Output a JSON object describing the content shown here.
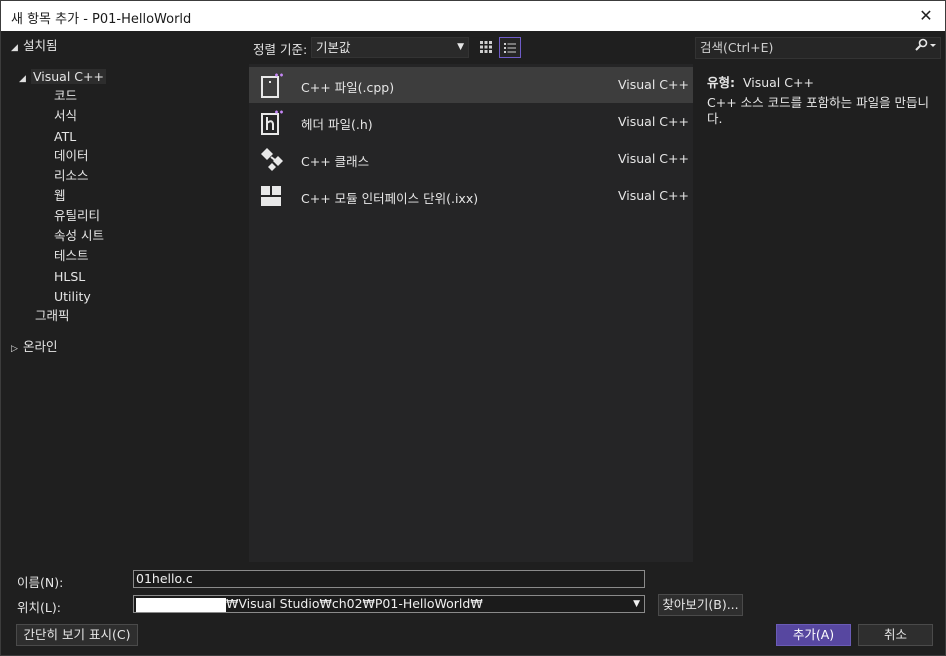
{
  "window": {
    "title": "새 항목 추가 - P01-HelloWorld",
    "close": "✕"
  },
  "tree": {
    "installed": "설치됨",
    "visual_cpp": "Visual C++",
    "children": [
      "코드",
      "서식",
      "ATL",
      "데이터",
      "리소스",
      "웹",
      "유틸리티",
      "속성 시트",
      "테스트",
      "HLSL",
      "Utility"
    ],
    "graphics": "그래픽",
    "online": "온라인"
  },
  "toolbar": {
    "sort_label": "정렬 기준:",
    "sort_value": "기본값",
    "search_placeholder": "검색(Ctrl+E)"
  },
  "items": [
    {
      "name": "C++ 파일(.cpp)",
      "lang": "Visual C++",
      "icon": "cpp-file-icon"
    },
    {
      "name": "헤더 파일(.h)",
      "lang": "Visual C++",
      "icon": "header-file-icon"
    },
    {
      "name": "C++ 클래스",
      "lang": "Visual C++",
      "icon": "cpp-class-icon"
    },
    {
      "name": "C++ 모듈 인터페이스 단위(.ixx)",
      "lang": "Visual C++",
      "icon": "module-icon"
    }
  ],
  "detail": {
    "type_label": "유형:",
    "type_value": "Visual C++",
    "description": "C++ 소스 코드를 포함하는 파일을 만듭니다."
  },
  "form": {
    "name_label": "이름(N):",
    "name_value": "01hello.c",
    "location_label": "위치(L):",
    "location_value": "₩Visual Studio₩ch02₩P01-HelloWorld₩",
    "browse": "찾아보기(B)...",
    "compact": "간단히 보기 표시(C)",
    "add": "추가(A)",
    "cancel": "취소"
  },
  "colors": {
    "accent": "#5747a0",
    "icon_accent": "#c586f7"
  }
}
